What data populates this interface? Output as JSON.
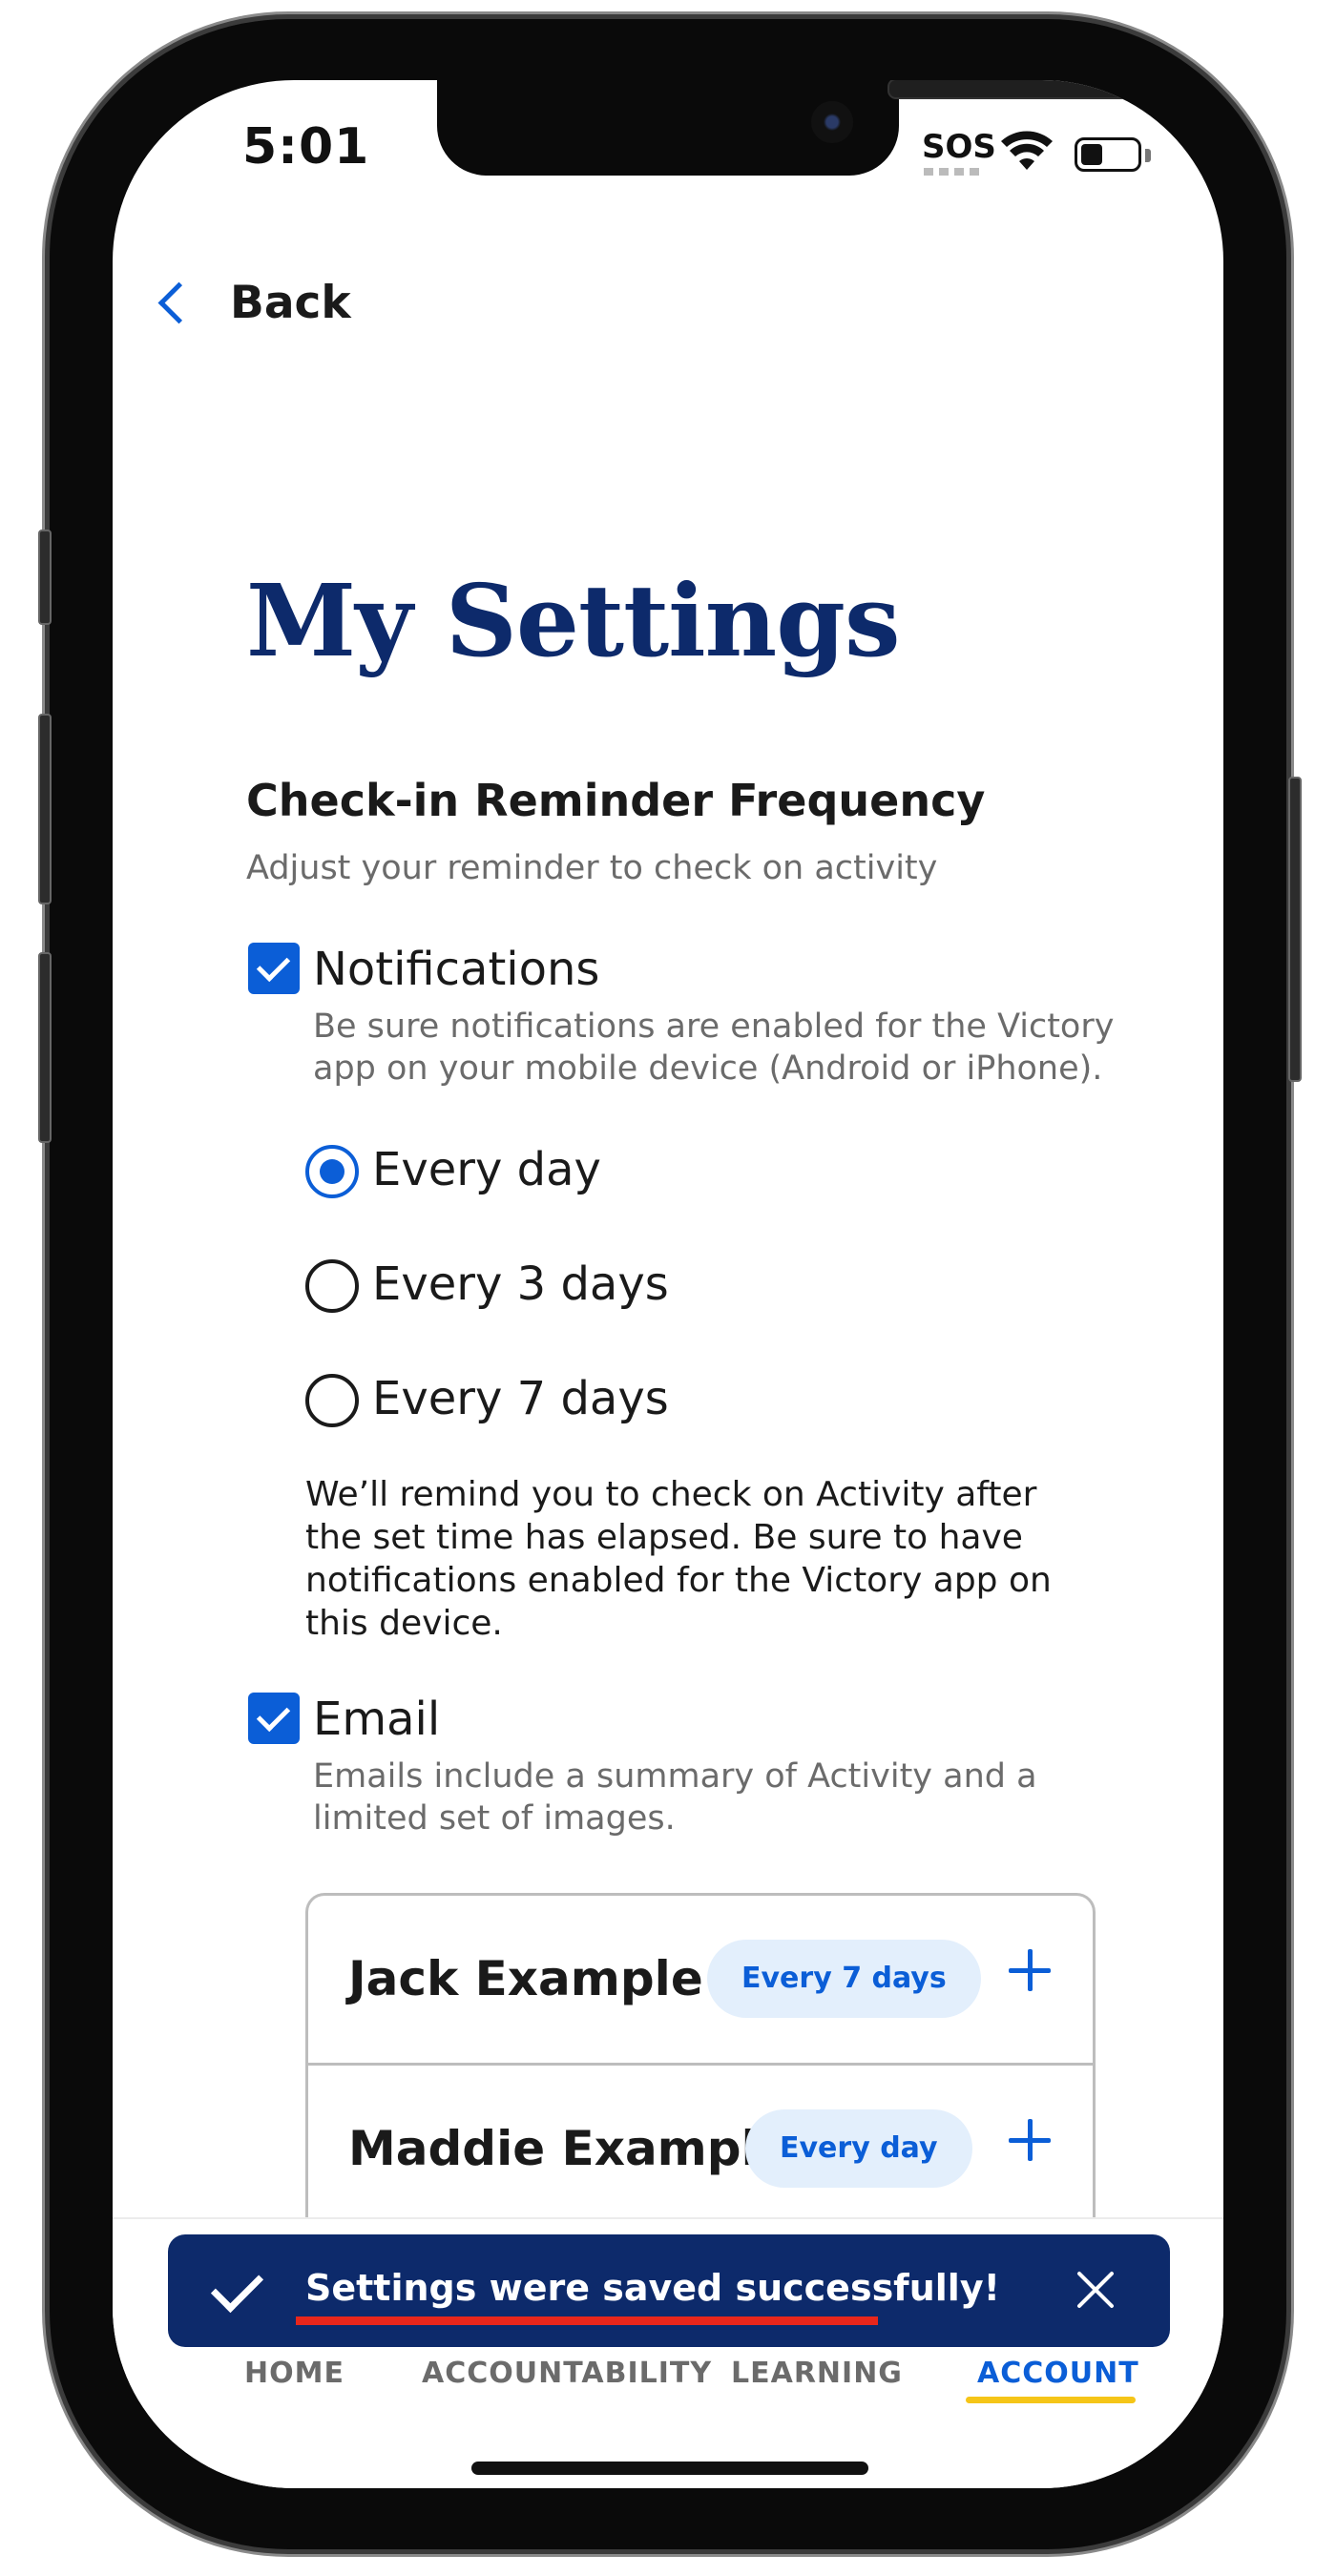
{
  "status_bar": {
    "time": "5:01",
    "sos": "SOS"
  },
  "header": {
    "back_label": "Back",
    "title": "My Settings"
  },
  "reminder": {
    "title": "Check-in Reminder Frequency",
    "subtitle": "Adjust your reminder to check on activity",
    "notifications": {
      "label": "Notifications",
      "checked": true,
      "help_line1": "Be sure notifications are enabled for the Victory",
      "help_line2": "app on your mobile device (Android or iPhone)."
    },
    "frequency_options": [
      {
        "label": "Every day",
        "selected": true
      },
      {
        "label": "Every 3 days",
        "selected": false
      },
      {
        "label": "Every 7 days",
        "selected": false
      }
    ],
    "note": "We’ll remind you to check on Activity after the set time has elapsed. Be sure to have notifications enabled for the Victory app on this device.",
    "email": {
      "label": "Email",
      "checked": true,
      "help_line1": "Emails include a summary of Activity and a",
      "help_line2": "limited set of images."
    },
    "contacts": [
      {
        "name": "Jack Example",
        "frequency": "Every 7 days"
      },
      {
        "name": "Maddie Example",
        "frequency": "Every day"
      }
    ]
  },
  "toast": {
    "message": "Settings were saved successfully!"
  },
  "nav": {
    "items": [
      {
        "label": "HOME"
      },
      {
        "label": "ACCOUNTABILITY"
      },
      {
        "label": "LEARNING"
      },
      {
        "label": "ACCOUNT",
        "active": true
      }
    ]
  },
  "colors": {
    "primary": "#0b5ed7",
    "navy": "#0d2a6b",
    "accent_yellow": "#f5c518",
    "annotation_red": "#e8261b"
  }
}
